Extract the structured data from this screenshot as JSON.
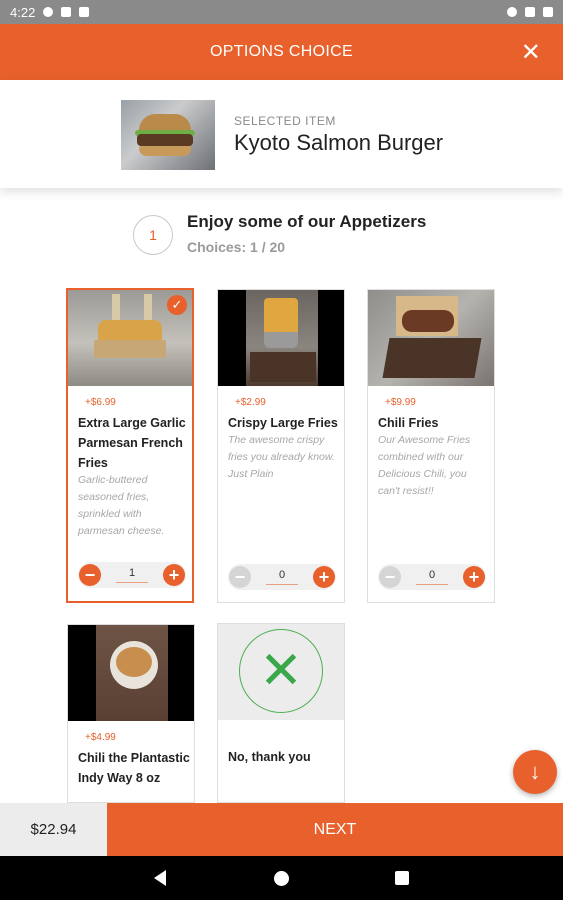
{
  "status_bar": {
    "time": "4:22"
  },
  "header": {
    "title": "OPTIONS CHOICE",
    "close_icon": "close-icon"
  },
  "selected_item": {
    "label": "SELECTED ITEM",
    "name": "Kyoto Salmon Burger"
  },
  "step": {
    "number": "1",
    "title": "Enjoy some of our Appetizers",
    "choices": "Choices: 1 / 20"
  },
  "items": [
    {
      "price": "+$6.99",
      "name": "Extra Large Garlic Parmesan French Fries",
      "description": "Garlic-buttered seasoned fries, sprinkled with parmesan cheese.",
      "quantity": "1",
      "selected": true
    },
    {
      "price": "+$2.99",
      "name": "Crispy Large Fries",
      "description": "The awesome crispy fries you already know. Just Plain",
      "quantity": "0",
      "selected": false
    },
    {
      "price": "+$9.99",
      "name": "Chili Fries",
      "description": "Our Awesome Fries combined with our Delicious Chili, you can't resist!!",
      "quantity": "0",
      "selected": false
    },
    {
      "price": "+$4.99",
      "name": "Chili the Plantastic Indy Way 8 oz",
      "selected": false
    },
    {
      "name": "No, thank you",
      "icon": "x-icon",
      "selected": false
    }
  ],
  "footer": {
    "total": "$22.94",
    "next_label": "NEXT"
  },
  "colors": {
    "accent": "#e8602c",
    "decline_green": "#3aa84a"
  }
}
